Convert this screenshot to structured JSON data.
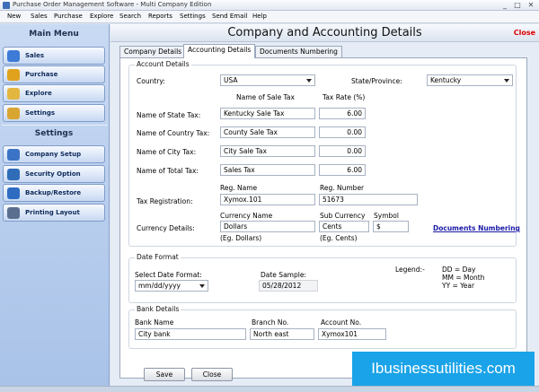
{
  "window": {
    "title": "Purchase Order Management Software - Multi Company Edition",
    "min": "_",
    "max": "□",
    "close": "✕"
  },
  "menu": [
    "New",
    "Sales",
    "Purchase",
    "Explore",
    "Search",
    "Reports",
    "Settings",
    "Send Email",
    "Help"
  ],
  "sidebar": {
    "main_menu_title": "Main Menu",
    "main_items": [
      {
        "label": "Sales",
        "icon": "sales-icon",
        "color": "#3d7bd6"
      },
      {
        "label": "Purchase",
        "icon": "purchase-icon",
        "color": "#e0a21c"
      },
      {
        "label": "Explore",
        "icon": "explore-icon",
        "color": "#e3b640"
      },
      {
        "label": "Settings",
        "icon": "settings-icon",
        "color": "#d9a531"
      }
    ],
    "settings_title": "Settings",
    "settings_items": [
      {
        "label": "Company Setup",
        "icon": "company-setup-icon",
        "color": "#3b74c7"
      },
      {
        "label": "Security Option",
        "icon": "security-icon",
        "color": "#2f6db8"
      },
      {
        "label": "Backup/Restore",
        "icon": "backup-icon",
        "color": "#2e6cc2"
      },
      {
        "label": "Printing Layout",
        "icon": "printer-icon",
        "color": "#5a6f8f"
      }
    ]
  },
  "header": {
    "title": "Company and Accounting Details",
    "close": "Close"
  },
  "tabs": [
    "Company Details",
    "Accounting Details",
    "Documents Numbering"
  ],
  "account": {
    "legend": "Account Details",
    "country_label": "Country:",
    "country_value": "USA",
    "state_label": "State/Province:",
    "state_value": "Kentucky",
    "col_name_header": "Name of Sale Tax",
    "col_rate_header": "Tax Rate (%)",
    "rows": [
      {
        "label": "Name of State Tax:",
        "name": "Kentucky Sale Tax",
        "rate": "6.00"
      },
      {
        "label": "Name of Country Tax:",
        "name": "County Sale Tax",
        "rate": "0.00"
      },
      {
        "label": "Name of City Tax:",
        "name": "City Sale Tax",
        "rate": "0.00"
      },
      {
        "label": "Name of Total Tax:",
        "name": "Sales Tax",
        "rate": "6.00"
      }
    ],
    "reg_name_header": "Reg. Name",
    "reg_number_header": "Reg. Number",
    "tax_reg_label": "Tax Registration:",
    "reg_name_value": "Xymox.101",
    "reg_number_value": "51673",
    "currency_label": "Currency Details:",
    "currency_name_header": "Currency Name",
    "currency_name_value": "Dollars",
    "currency_name_hint": "(Eg. Dollars)",
    "sub_currency_header": "Sub Currency",
    "sub_currency_value": "Cents",
    "sub_currency_hint": "(Eg. Cents)",
    "symbol_header": "Symbol",
    "symbol_value": "$",
    "documents_link": "Documents Numbering"
  },
  "date": {
    "legend": "Date Format",
    "select_label": "Select Date Format:",
    "select_value": "mm/dd/yyyy",
    "sample_label": "Date Sample:",
    "sample_value": "05/28/2012",
    "legend_label": "Legend:-",
    "legend_day": "DD = Day",
    "legend_month": "MM = Month",
    "legend_year": "YY = Year"
  },
  "bank": {
    "legend": "Bank Details",
    "bank_name_label": "Bank Name",
    "bank_name_value": "City bank",
    "branch_label": "Branch No.",
    "branch_value": "North east",
    "account_label": "Account No.",
    "account_value": "Xymox101"
  },
  "buttons": {
    "save": "Save",
    "close": "Close"
  },
  "brand": "Ibusinessutilities.com"
}
